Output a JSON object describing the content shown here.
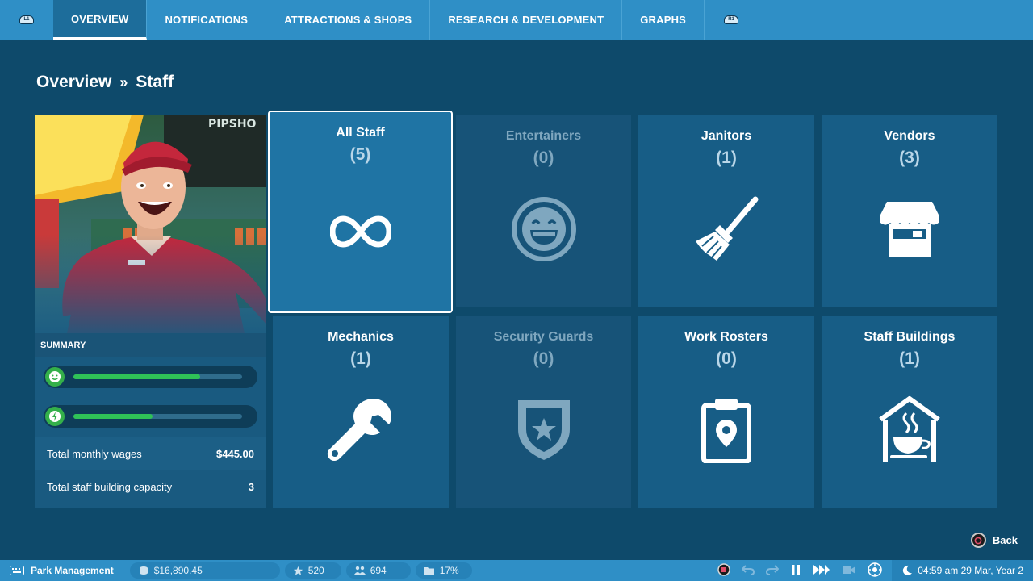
{
  "tabs": {
    "left_bumper": "L1",
    "right_bumper": "R1",
    "items": [
      "OVERVIEW",
      "NOTIFICATIONS",
      "ATTRACTIONS & SHOPS",
      "RESEARCH & DEVELOPMENT",
      "GRAPHS"
    ],
    "active_index": 0
  },
  "breadcrumb": {
    "parent": "Overview",
    "separator": "»",
    "current": "Staff"
  },
  "summary": {
    "title": "SUMMARY",
    "happiness_level": 0.75,
    "energy_level": 0.47,
    "rows": [
      {
        "label": "Total monthly wages",
        "value": "$445.00"
      },
      {
        "label": "Total staff building capacity",
        "value": "3"
      }
    ]
  },
  "tiles": [
    {
      "name": "All Staff",
      "count": "(5)",
      "icon": "infinity-icon",
      "state": "selected"
    },
    {
      "name": "Entertainers",
      "count": "(0)",
      "icon": "smiley-icon",
      "state": "disabled"
    },
    {
      "name": "Janitors",
      "count": "(1)",
      "icon": "broom-icon",
      "state": "normal"
    },
    {
      "name": "Vendors",
      "count": "(3)",
      "icon": "stall-icon",
      "state": "normal"
    },
    {
      "name": "Mechanics",
      "count": "(1)",
      "icon": "wrench-icon",
      "state": "normal"
    },
    {
      "name": "Security Guards",
      "count": "(0)",
      "icon": "shield-icon",
      "state": "disabled"
    },
    {
      "name": "Work Rosters",
      "count": "(0)",
      "icon": "clipboard-icon",
      "state": "normal"
    },
    {
      "name": "Staff Buildings",
      "count": "(1)",
      "icon": "staff-building-icon",
      "state": "normal"
    }
  ],
  "back": {
    "label": "Back"
  },
  "bottom": {
    "title": "Park Management",
    "money": "$16,890.45",
    "rating": "520",
    "guests": "694",
    "percent": "17%",
    "datetime": "04:59 am 29 Mar, Year 2"
  },
  "colors": {
    "background": "#0e4a6b",
    "tab_bar": "#2f8fc6",
    "tile": "#175d86",
    "meter_green": "#2fc257"
  }
}
